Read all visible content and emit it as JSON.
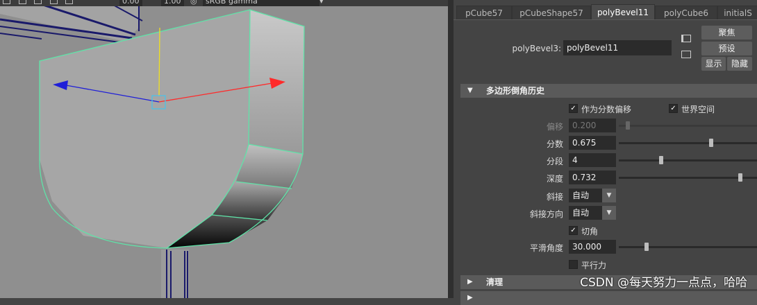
{
  "viewport_toolbar": {
    "exposure_value": "0.00",
    "gamma_value": "1.00",
    "colorspace": "sRGB gamma"
  },
  "tabs": [
    {
      "label": "pCube57",
      "active": false
    },
    {
      "label": "pCubeShape57",
      "active": false
    },
    {
      "label": "polyBevel11",
      "active": true
    },
    {
      "label": "polyCube6",
      "active": false
    },
    {
      "label": "initialS",
      "active": false
    }
  ],
  "node": {
    "label": "polyBevel3:",
    "value": "polyBevel11"
  },
  "buttons": {
    "focus": "聚焦",
    "preset": "预设",
    "show": "显示",
    "hide": "隐藏"
  },
  "sections": {
    "history": "多边形倒角历史",
    "cleanup": "清理"
  },
  "checks": {
    "fraction_offset": {
      "label": "作为分数偏移",
      "checked": true
    },
    "world_space": {
      "label": "世界空间",
      "checked": true
    },
    "chamfer": {
      "label": "切角",
      "checked": true
    },
    "parallel": {
      "label": "平行力",
      "checked": false
    }
  },
  "attrs": {
    "offset": {
      "label": "偏移",
      "value": "0.200",
      "slider": 0.05,
      "enabled": false
    },
    "fraction": {
      "label": "分数",
      "value": "0.675",
      "slider": 0.675,
      "enabled": true
    },
    "segments": {
      "label": "分段",
      "value": "4",
      "slider": 0.3,
      "enabled": true
    },
    "depth": {
      "label": "深度",
      "value": "0.732",
      "slider": 0.89,
      "enabled": true
    },
    "miter": {
      "label": "斜接",
      "value": "自动"
    },
    "miter_dir": {
      "label": "斜接方向",
      "value": "自动"
    },
    "smooth_angle": {
      "label": "平滑角度",
      "value": "30.000",
      "slider": 0.19,
      "enabled": true
    }
  },
  "watermark": "CSDN @每天努力一点点，哈哈",
  "colors": {
    "wireframe": "#5fe3a8",
    "axis_x": "#ff2a2a",
    "axis_z": "#1f1fd8",
    "axis_y": "#f0e020",
    "panel": "#444444"
  }
}
